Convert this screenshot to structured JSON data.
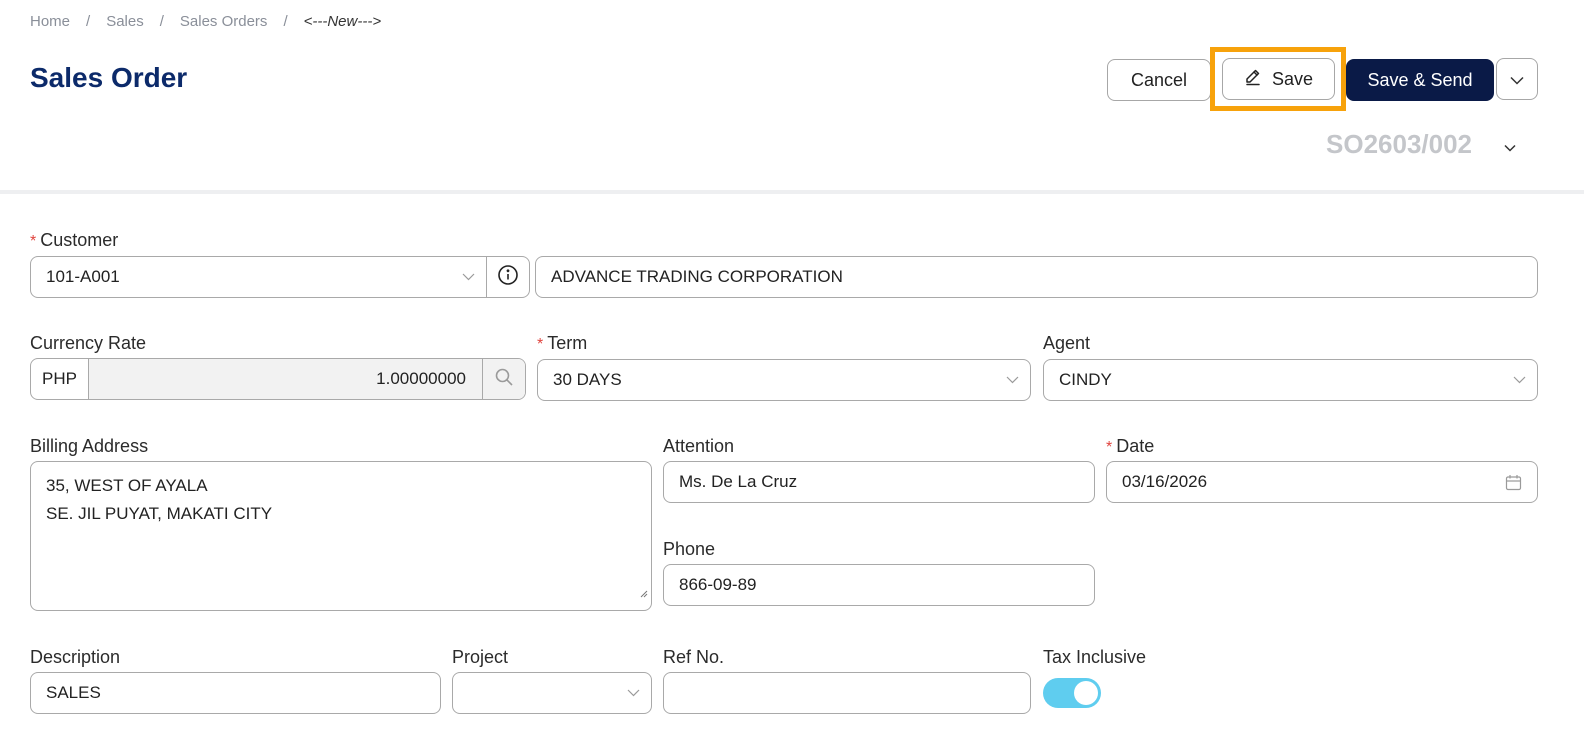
{
  "breadcrumb": {
    "items": [
      "Home",
      "Sales",
      "Sales Orders"
    ],
    "separator": "/",
    "current": "<---New--->"
  },
  "header": {
    "title": "Sales Order",
    "cancel_label": "Cancel",
    "save_label": "Save",
    "save_send_label": "Save & Send",
    "doc_number": "SO2603/002"
  },
  "form": {
    "customer": {
      "label": "Customer",
      "code": "101-A001",
      "name": "ADVANCE TRADING CORPORATION"
    },
    "currency_rate": {
      "label": "Currency Rate",
      "currency": "PHP",
      "rate": "1.00000000"
    },
    "term": {
      "label": "Term",
      "value": "30 DAYS"
    },
    "agent": {
      "label": "Agent",
      "value": "CINDY"
    },
    "billing_address": {
      "label": "Billing Address",
      "line1": "35, WEST OF AYALA",
      "line2": "SE. JIL PUYAT, MAKATI CITY"
    },
    "attention": {
      "label": "Attention",
      "value": "Ms. De La Cruz"
    },
    "date": {
      "label": "Date",
      "value": "03/16/2026"
    },
    "phone": {
      "label": "Phone",
      "value": "866-09-89"
    },
    "description": {
      "label": "Description",
      "value": "SALES"
    },
    "project": {
      "label": "Project",
      "value": ""
    },
    "ref_no": {
      "label": "Ref No.",
      "value": ""
    },
    "tax_inclusive": {
      "label": "Tax Inclusive",
      "enabled": true
    }
  },
  "colors": {
    "title": "#0c2a6a",
    "primary_button": "#0a1a47",
    "highlight": "#f7a20b",
    "toggle_on": "#5fcdef",
    "required": "#e0443e"
  },
  "icons": [
    "pencil-icon",
    "chevron-down-icon",
    "info-icon",
    "search-icon",
    "calendar-icon",
    "resize-grip-icon"
  ]
}
